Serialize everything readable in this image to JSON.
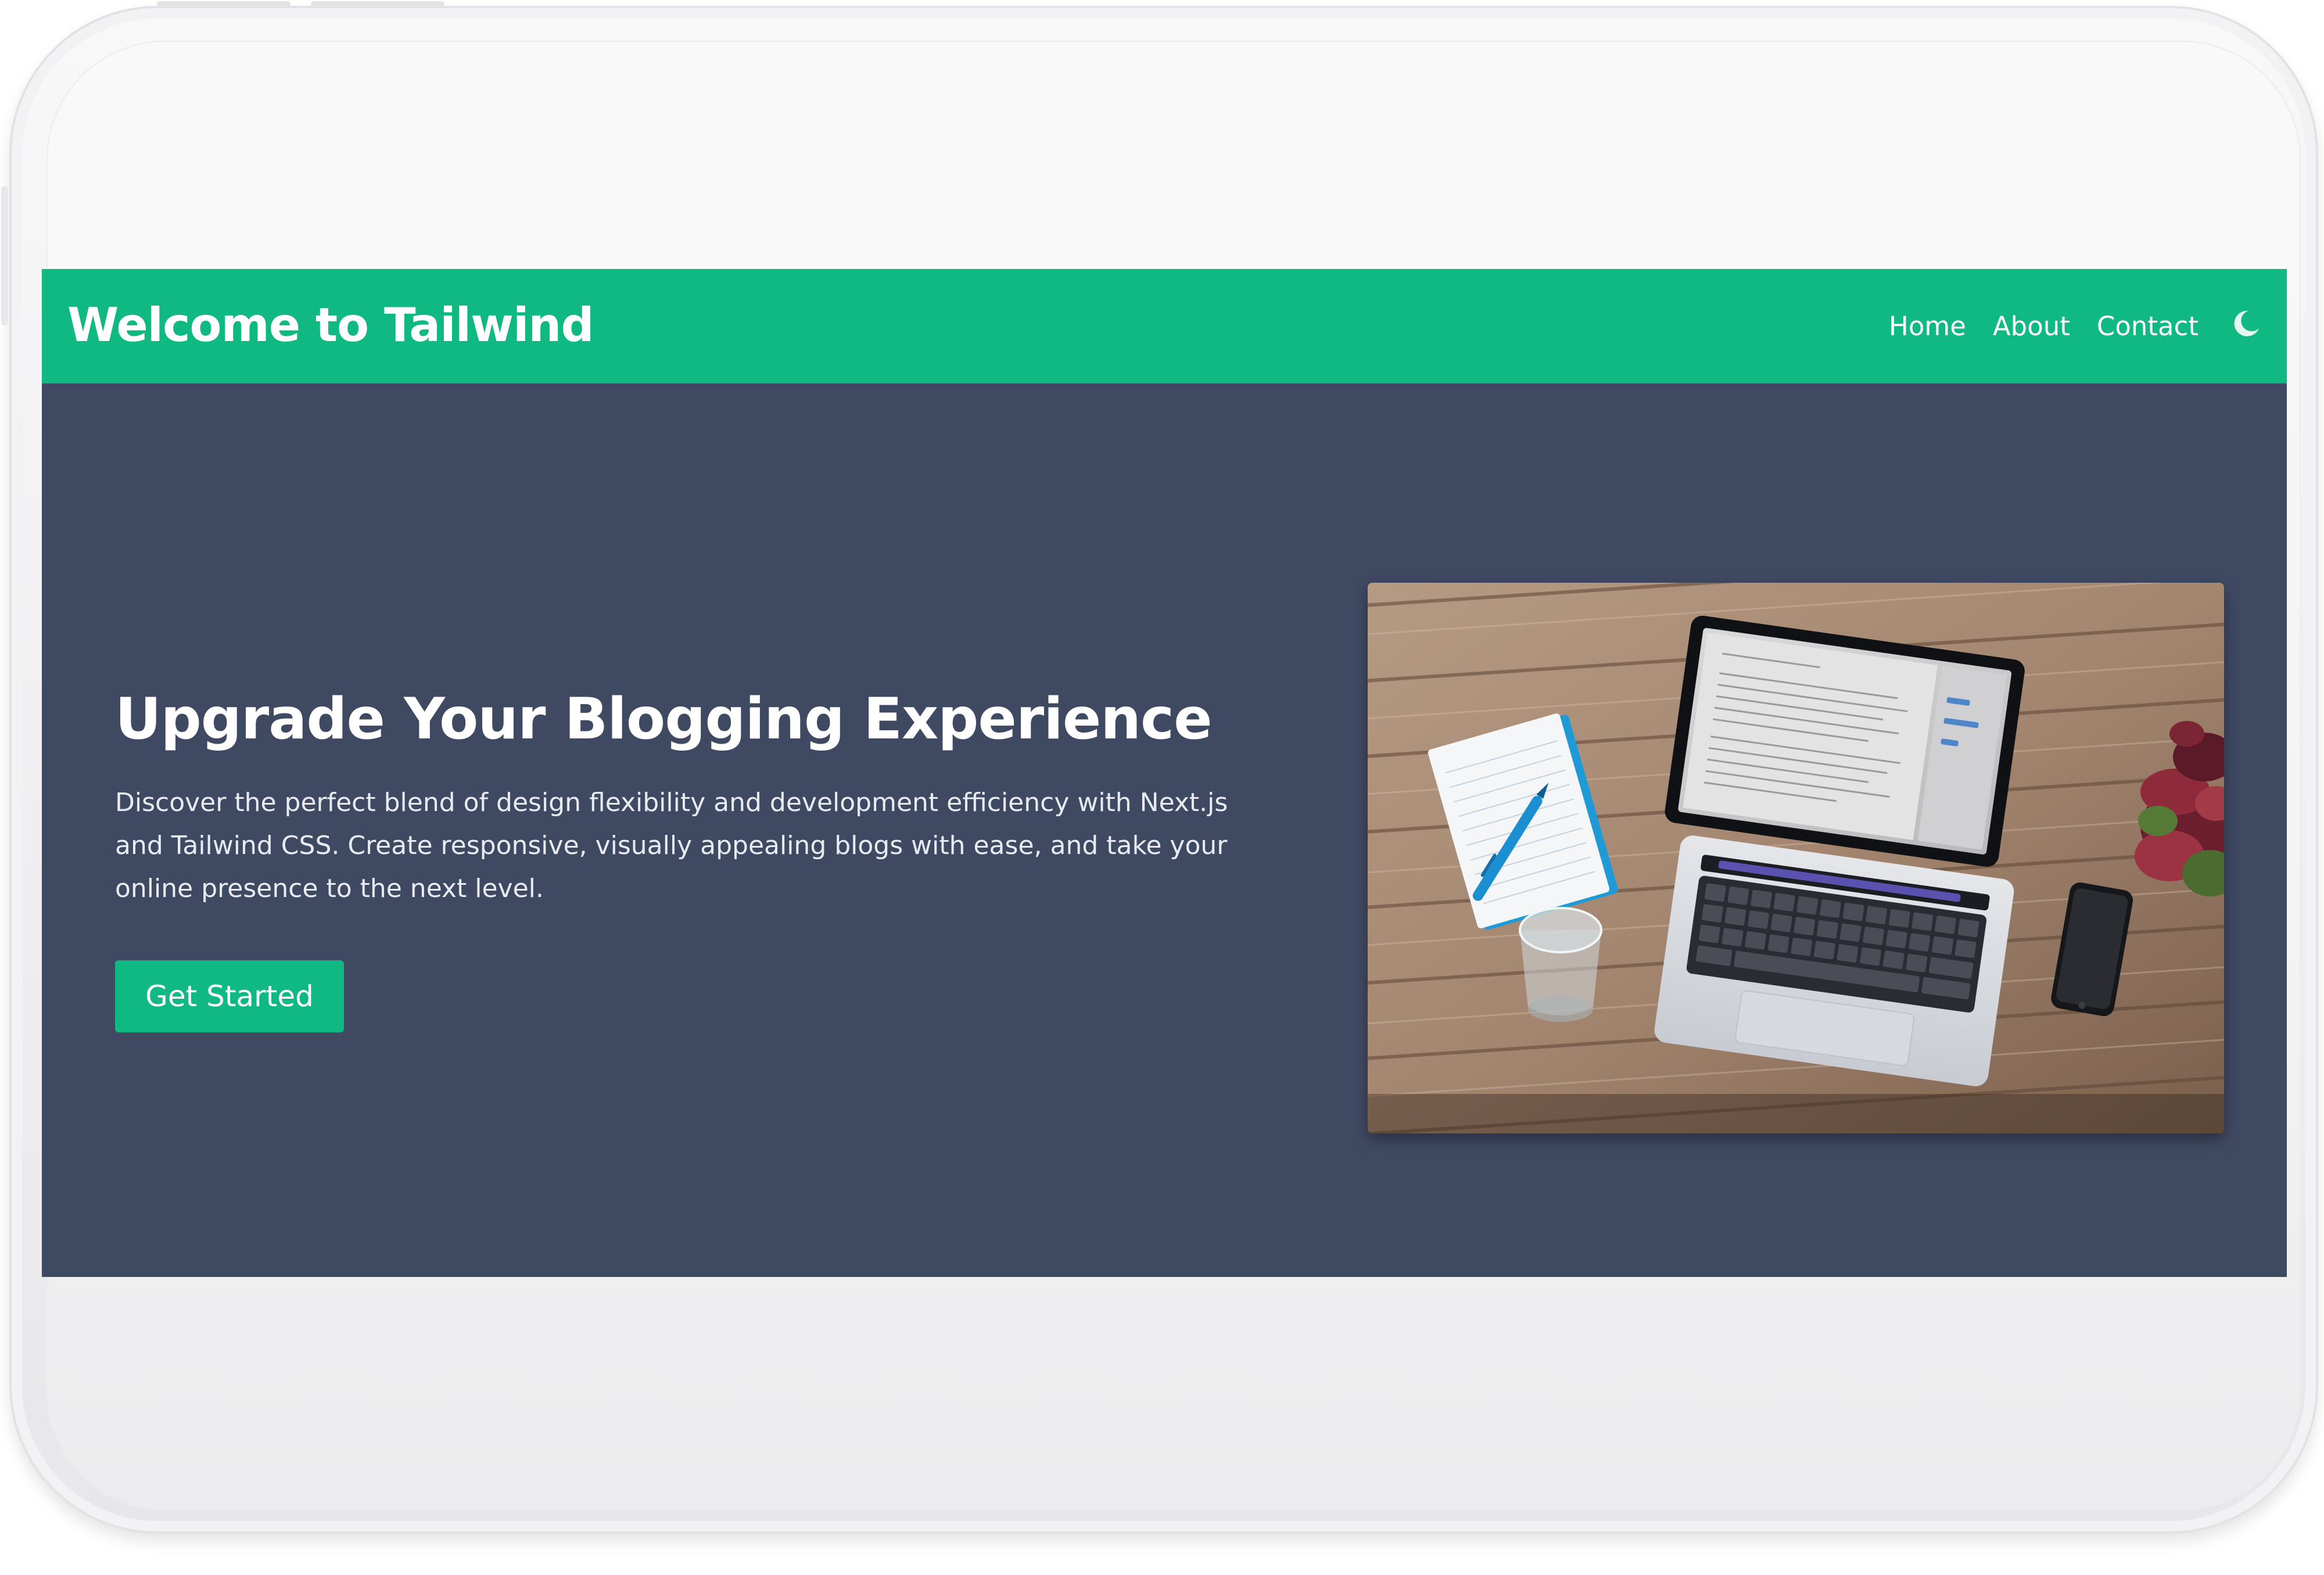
{
  "navbar": {
    "brand": "Welcome to Tailwind",
    "links": [
      {
        "label": "Home"
      },
      {
        "label": "About"
      },
      {
        "label": "Contact"
      }
    ],
    "theme_toggle_icon": "moon-icon"
  },
  "hero": {
    "heading": "Upgrade Your Blogging Experience",
    "description": "Discover the perfect blend of design flexibility and development efficiency with Next.js and Tailwind CSS. Create responsive, visually appealing blogs with ease, and take your online presence to the next level.",
    "cta_label": "Get Started",
    "image_icon": "laptop-on-desk-photo"
  },
  "colors": {
    "accent": "#10b981",
    "background": "#3f4962",
    "text": "#ffffff"
  }
}
